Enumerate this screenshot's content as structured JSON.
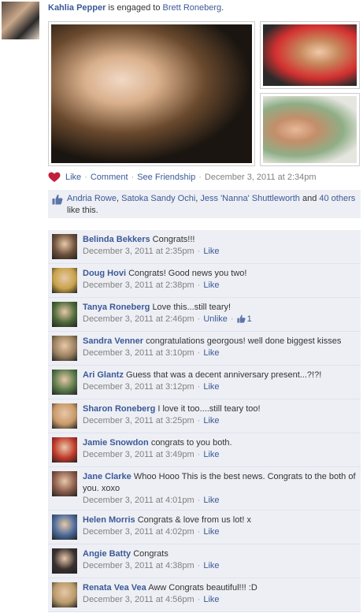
{
  "story": {
    "actor": "Kahlia Pepper",
    "verb": " is engaged to ",
    "target": "Brett Roneberg",
    "period": "."
  },
  "actions": {
    "like": "Like",
    "comment": "Comment",
    "see_friendship": "See Friendship",
    "timestamp": "December 3, 2011 at 2:34pm",
    "separator": "·"
  },
  "likes": {
    "names": [
      "Andria Rowe",
      "Satoka Sandy Ochi",
      "Jess 'Nanna' Shuttleworth"
    ],
    "comma": ", ",
    "and_text": " and ",
    "others_link": "40 others",
    "suffix": "like this."
  },
  "comments": [
    {
      "name": "Belinda Bekkers",
      "text": "Congrats!!!",
      "time": "December 3, 2011 at 2:35pm",
      "action": "Like",
      "color": "#6b4f3a"
    },
    {
      "name": "Doug Hovi",
      "text": "Congrats! Good news you two!",
      "time": "December 3, 2011 at 2:38pm",
      "action": "Like",
      "color": "#c8a24a"
    },
    {
      "name": "Tanya Roneberg",
      "text": "Love this...still teary!",
      "time": "December 3, 2011 at 2:46pm",
      "action": "Unlike",
      "like_count": "1",
      "color": "#4d6a3a"
    },
    {
      "name": "Sandra Venner",
      "text": "congratulations georgous! well done biggest kisses",
      "time": "December 3, 2011 at 3:10pm",
      "action": "Like",
      "color": "#9a8060"
    },
    {
      "name": "Ari Glantz",
      "text": "Guess that was a decent anniversary present...?!?!",
      "time": "December 3, 2011 at 3:12pm",
      "action": "Like",
      "color": "#5a7a4a"
    },
    {
      "name": "Sharon Roneberg",
      "text": "I love it too....still teary too!",
      "time": "December 3, 2011 at 3:25pm",
      "action": "Like",
      "color": "#c99a6a"
    },
    {
      "name": "Jamie Snowdon",
      "text": "congrats to you both.",
      "time": "December 3, 2011 at 3:49pm",
      "action": "Like",
      "color": "#c0392b"
    },
    {
      "name": "Jane Clarke",
      "text": "Whoo Hooo This is the best news. Congrats to the both of you. xoxo",
      "time": "December 3, 2011 at 4:01pm",
      "action": "Like",
      "color": "#8a5a4a"
    },
    {
      "name": "Helen Morris",
      "text": "Congrats & love from us lot! x",
      "time": "December 3, 2011 at 4:02pm",
      "action": "Like",
      "color": "#4a6a9a"
    },
    {
      "name": "Angie Batty",
      "text": "Congrats",
      "time": "December 3, 2011 at 4:38pm",
      "action": "Like",
      "color": "#3a3030"
    },
    {
      "name": "Renata Vea Vea",
      "text": "Aww Congrats beautiful!!! :D",
      "time": "December 3, 2011 at 4:56pm",
      "action": "Like",
      "color": "#b89a6a"
    }
  ],
  "colors": {
    "link": "#3b5998",
    "meta": "#808080",
    "comment_bg": "#edeff4",
    "heart": "#c2203a"
  }
}
